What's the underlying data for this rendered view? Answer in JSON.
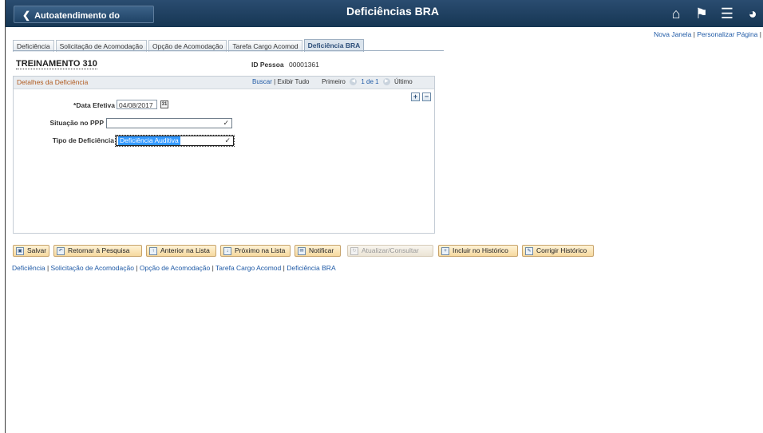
{
  "header": {
    "back_label": "Autoatendimento do Gerente",
    "title": "Deficiências BRA",
    "icons": [
      "home-icon",
      "flag-icon",
      "menu-icon",
      "navbar-icon"
    ]
  },
  "top_links": {
    "new_window": "Nova Janela",
    "personalize": "Personalizar Página"
  },
  "tabs": [
    {
      "label": "Deficiência"
    },
    {
      "label": "Solicitação de Acomodação"
    },
    {
      "label": "Opção de Acomodação"
    },
    {
      "label": "Tarefa Cargo Acomod"
    },
    {
      "label": "Deficiência BRA"
    }
  ],
  "entity": {
    "name": "TREINAMENTO 310",
    "id_label": "ID Pessoa",
    "id_value": "00001361"
  },
  "panel": {
    "title": "Detalhes da Deficiência",
    "find": "Buscar",
    "view_all": "Exibir Tudo",
    "first": "Primeiro",
    "range": "1 de 1",
    "last": "Último"
  },
  "fields": {
    "effdt_label": "*Data Efetiva",
    "effdt_value": "04/08/2017",
    "ppp_label": "Situação no PPP",
    "ppp_value": "",
    "type_label": "Tipo de Deficiência",
    "type_value": "Deficiência Auditiva"
  },
  "toolbar": {
    "save": "Salvar",
    "return": "Retornar à Pesquisa",
    "prev": "Anterior na Lista",
    "next": "Próximo na Lista",
    "notify": "Notificar",
    "refresh": "Atualizar/Consultar",
    "add_history": "Incluir no Histórico",
    "correct_history": "Corrigir Histórico"
  },
  "bottom_links": [
    {
      "label": "Deficiência"
    },
    {
      "label": "Solicitação de Acomodação"
    },
    {
      "label": "Opção de Acomodação"
    },
    {
      "label": "Tarefa Cargo Acomod"
    },
    {
      "label": "Deficiência BRA"
    }
  ],
  "colors": {
    "banner": "#1f4366",
    "link": "#1f5aa6",
    "panel_title": "#b05a1f",
    "selection": "#3399ff"
  }
}
